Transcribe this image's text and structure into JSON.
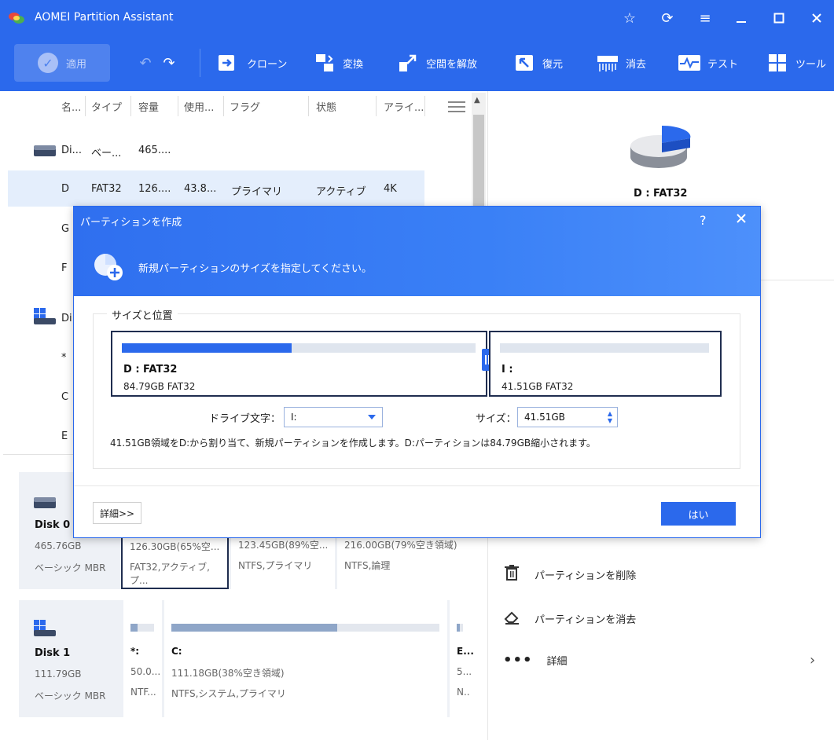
{
  "window": {
    "title": "AOMEI Partition Assistant"
  },
  "toolbar": {
    "apply": "適用",
    "clone": "クローン",
    "convert": "変換",
    "free_space": "空間を解放",
    "restore": "復元",
    "wipe": "消去",
    "test": "テスト",
    "tools": "ツール"
  },
  "columns": [
    "名...",
    "タイプ",
    "容量",
    "使用...",
    "フラグ",
    "状態",
    "アライ..."
  ],
  "partition_list": {
    "disk0": {
      "name": "Di...",
      "type": "ベー...",
      "capacity": "465...."
    },
    "selected_row": {
      "name": "D",
      "type": "FAT32",
      "capacity": "126....",
      "used": "43.8...",
      "flag": "プライマリ",
      "status": "アクティブ",
      "align": "4K"
    },
    "rows": [
      {
        "name": "G"
      },
      {
        "name": "F"
      }
    ],
    "disk1": {
      "name": "Di"
    },
    "rows2": [
      {
        "name": "*"
      },
      {
        "name": "C"
      },
      {
        "name": "E"
      }
    ]
  },
  "disk_map": {
    "disk0": {
      "name": "Disk 0",
      "size": "465.76GB",
      "type": "ベーシック MBR",
      "partitions": [
        {
          "line1": "126.30GB(65%空...",
          "line2": "FAT32,アクティブ,プ..."
        },
        {
          "line1": "123.45GB(89%空...",
          "line2": "NTFS,プライマリ"
        },
        {
          "line1": "216.00GB(79%空き領域)",
          "line2": "NTFS,論理"
        }
      ]
    },
    "disk1": {
      "name": "Disk 1",
      "size": "111.79GB",
      "type": "ベーシック MBR",
      "partitions": [
        {
          "label": "*:",
          "line1": "50.0...",
          "line2": "NTF...",
          "used_fraction": 0.3
        },
        {
          "label": "C:",
          "line1": "111.18GB(38%空き領域)",
          "line2": "NTFS,システム,プライマリ",
          "used_fraction": 0.62
        },
        {
          "label": "E...",
          "line1": "5...",
          "line2": "N..",
          "used_fraction": 0.5
        }
      ]
    }
  },
  "right_panel": {
    "selected_label": "D : FAT32",
    "actions": {
      "delete": "パーティションを削除",
      "wipe": "パーティションを消去",
      "more": "詳細"
    }
  },
  "dialog": {
    "title": "パーティションを作成",
    "help": "?",
    "subtitle": "新規パーティションのサイズを指定してください。",
    "section": "サイズと位置",
    "left_partition": {
      "name": "D : FAT32",
      "size": "84.79GB FAT32",
      "used_fraction": 0.48
    },
    "right_partition": {
      "name": "I :",
      "size": "41.51GB FAT32",
      "used_fraction": 0.0
    },
    "drive_letter_label": "ドライブ文字：",
    "drive_letter_value": "I:",
    "size_label": "サイズ：",
    "size_value": "41.51GB",
    "note": "41.51GB領域をD:から割り当て、新規パーティションを作成します。D:パーティションは84.79GB縮小されます。",
    "detail_button": "詳細>>",
    "ok_button": "はい"
  },
  "colors": {
    "accent": "#2b69ec",
    "dark_border": "#1f2d4f"
  }
}
